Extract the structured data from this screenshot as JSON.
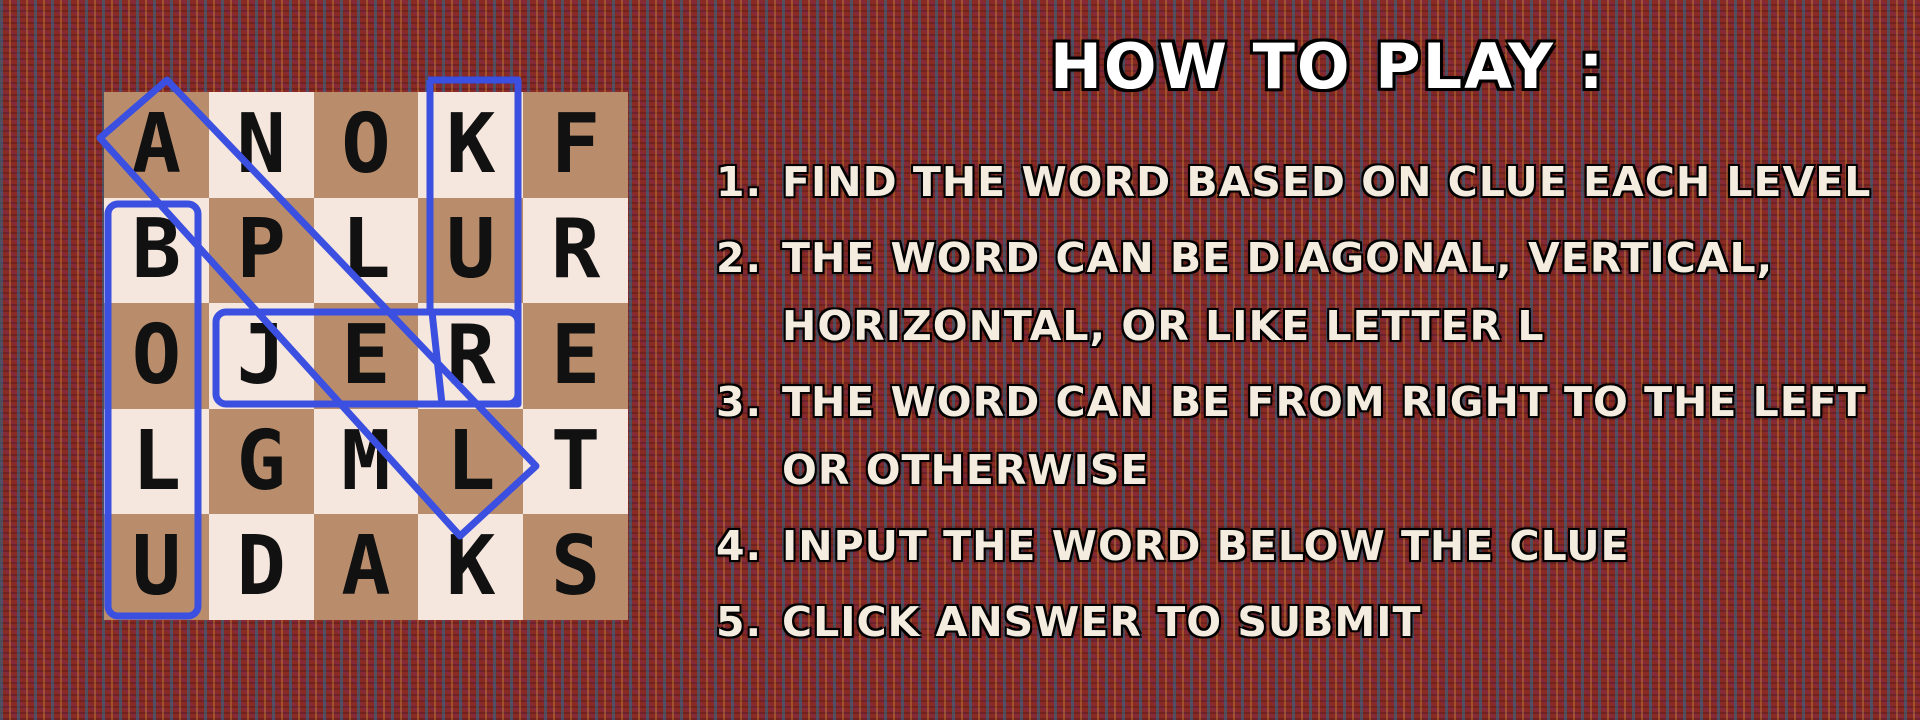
{
  "board": {
    "letters": [
      [
        "A",
        "N",
        "O",
        "K",
        "F"
      ],
      [
        "B",
        "P",
        "L",
        "U",
        "R"
      ],
      [
        "O",
        "J",
        "E",
        "R",
        "E"
      ],
      [
        "L",
        "G",
        "M",
        "L",
        "T"
      ],
      [
        "U",
        "D",
        "A",
        "K",
        "S"
      ]
    ]
  },
  "instructions": {
    "heading": "HOW TO PLAY :",
    "rules": [
      {
        "num": "1.",
        "text": "FIND THE WORD BASED ON CLUE EACH LEVEL"
      },
      {
        "num": "2.",
        "text": "THE WORD CAN BE DIAGONAL, VERTICAL,\nHORIZONTAL, OR LIKE LETTER L"
      },
      {
        "num": "3.",
        "text": "THE WORD CAN BE FROM RIGHT TO THE LEFT\nOR OTHERWISE"
      },
      {
        "num": "4.",
        "text": "INPUT THE WORD BELOW THE CLUE"
      },
      {
        "num": "5.",
        "text": "CLICK ANSWER TO SUBMIT"
      }
    ]
  },
  "colors": {
    "highlight": "#3b4fe0",
    "tile_dark": "#b98d6c",
    "tile_light": "#f5e6de"
  }
}
